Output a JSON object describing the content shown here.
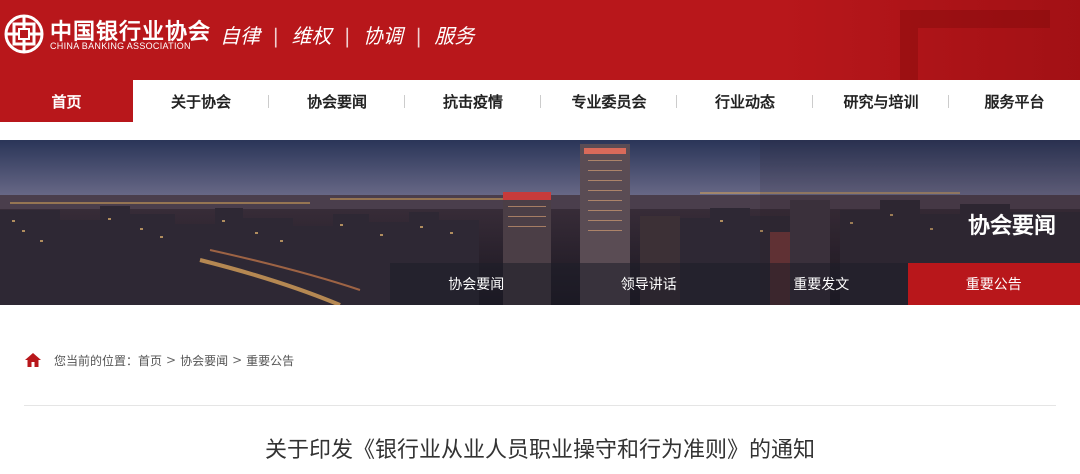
{
  "header": {
    "brand_cn": "中国银行业协会",
    "brand_en": "CHINA BANKING ASSOCIATION",
    "slogan": [
      "自律",
      "维权",
      "协调",
      "服务"
    ],
    "slogan_sep": "|",
    "logo": "cba-logo",
    "bg_color": "#b8171b"
  },
  "nav": {
    "items": [
      {
        "label": "首页",
        "active": true
      },
      {
        "label": "关于协会",
        "active": false
      },
      {
        "label": "协会要闻",
        "active": false
      },
      {
        "label": "抗击疫情",
        "active": false
      },
      {
        "label": "专业委员会",
        "active": false
      },
      {
        "label": "行业动态",
        "active": false
      },
      {
        "label": "研究与培训",
        "active": false
      },
      {
        "label": "服务平台",
        "active": false
      }
    ]
  },
  "banner": {
    "label": "协会要闻",
    "tabs": [
      {
        "label": "协会要闻",
        "active": false
      },
      {
        "label": "领导讲话",
        "active": false
      },
      {
        "label": "重要发文",
        "active": false
      },
      {
        "label": "重要公告",
        "active": true
      }
    ]
  },
  "breadcrumb": {
    "icon": "home-icon",
    "prefix": "您当前的位置：",
    "items": [
      "首页",
      "协会要闻",
      "重要公告"
    ],
    "sep": ">"
  },
  "article": {
    "title": "关于印发《银行业从业人员职业操守和行为准则》的通知"
  },
  "colors": {
    "accent": "#b8171b",
    "text": "#333333"
  }
}
